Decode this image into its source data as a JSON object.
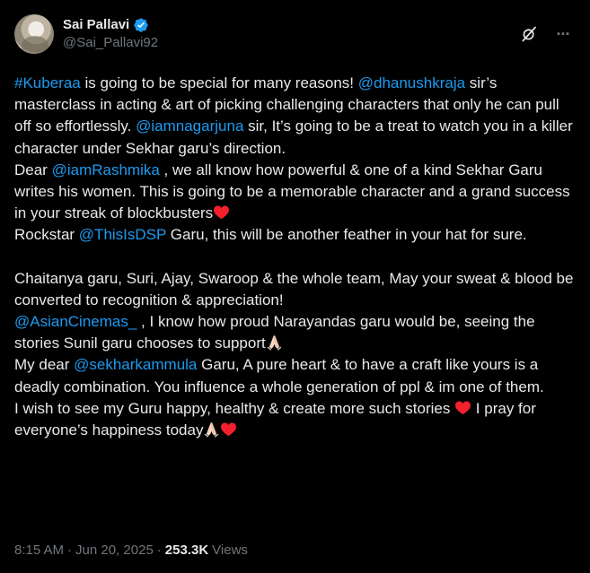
{
  "author": {
    "display_name": "Sai Pallavi",
    "handle": "@Sai_Pallavi92",
    "verified": true
  },
  "header_icons": [
    "grok-icon",
    "more-icon"
  ],
  "more_glyph": "···",
  "tweet": {
    "p1": {
      "hashtag": "#Kuberaa",
      "t1": " is going to be special for many reasons! ",
      "m1": "@dhanushkraja",
      "t2": " sir’s masterclass in acting & art of picking challenging characters that only he can pull off so effortlessly. ",
      "m2": "@iamnagarjuna",
      "t3": " sir, It’s going to be a treat to watch you in a killer character under Sekhar garu’s direction."
    },
    "p2": {
      "t1": "Dear ",
      "m1": "@iamRashmika",
      "t2": " , we all know how powerful & one of a kind Sekhar Garu writes his women. This is going to be a memorable character and a grand success in your streak of blockbusters"
    },
    "p3": {
      "t1": "Rockstar ",
      "m1": "@ThisIsDSP",
      "t2": " Garu, this will be another feather in your hat for sure."
    },
    "p4": {
      "t1": "Chaitanya garu, Suri, Ajay, Swaroop & the whole team, May your sweat & blood be converted to recognition & appreciation!"
    },
    "p5": {
      "m1": "@AsianCinemas_",
      "t1": " , I know how proud Narayandas garu would be, seeing the stories Sunil garu chooses to support"
    },
    "p6": {
      "t1": "My dear ",
      "m1": "@sekharkammula",
      "t2": " Garu, A pure heart & to have a craft like yours is a deadly combination. You influence a whole generation of ppl & im one of them."
    },
    "p7": {
      "t1": "I wish to see my Guru happy, healthy & create more such stories ",
      "t2": " I pray for everyone’s happiness today"
    }
  },
  "meta": {
    "time": "8:15 AM",
    "separator": "·",
    "date": "Jun 20, 2025",
    "views_count": "253.3K",
    "views_label": "Views"
  },
  "colors": {
    "background": "#000000",
    "text": "#e7e9ea",
    "secondary": "#71767b",
    "link": "#1d9bf0",
    "verified": "#1d9bf0",
    "heart": "#f4202d"
  }
}
